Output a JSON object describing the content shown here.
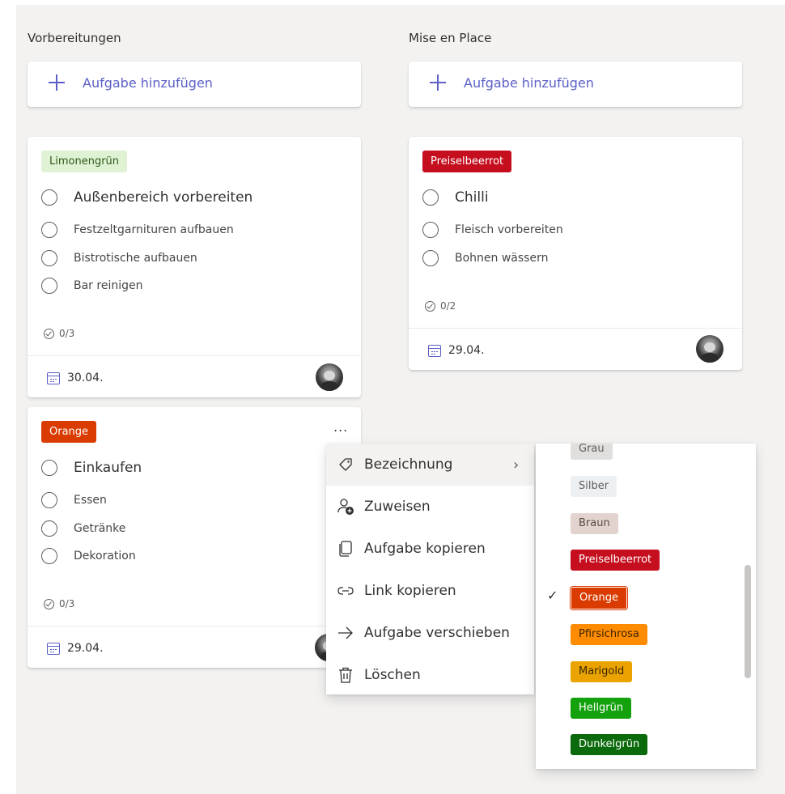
{
  "columns": [
    {
      "title": "Vorbereitungen",
      "add_label": "Aufgabe hinzufügen"
    },
    {
      "title": "Mise en Place",
      "add_label": "Aufgabe hinzufügen"
    }
  ],
  "cards": {
    "aussenbereich": {
      "label": "Limonengrün",
      "title": "Außenbereich vorbereiten",
      "items": [
        "Festzeltgarnituren aufbauen",
        "Bistrotische aufbauen",
        "Bar reinigen"
      ],
      "progress": "0/3",
      "date": "30.04."
    },
    "chilli": {
      "label": "Preiselbeerrot",
      "title": "Chilli",
      "items": [
        "Fleisch vorbereiten",
        "Bohnen wässern"
      ],
      "progress": "0/2",
      "date": "29.04."
    },
    "einkaufen": {
      "label": "Orange",
      "title": "Einkaufen",
      "items": [
        "Essen",
        "Getränke",
        "Dekoration"
      ],
      "progress": "0/3",
      "date": "29.04.",
      "more_label": "..."
    }
  },
  "context_menu": {
    "items": [
      {
        "label": "Bezeichnung",
        "icon": "tag-icon"
      },
      {
        "label": "Zuweisen",
        "icon": "person-add-icon"
      },
      {
        "label": "Aufgabe kopieren",
        "icon": "copy-icon"
      },
      {
        "label": "Link kopieren",
        "icon": "link-icon"
      },
      {
        "label": "Aufgabe verschieben",
        "icon": "arrow-right-icon"
      },
      {
        "label": "Löschen",
        "icon": "trash-icon"
      }
    ],
    "submenu_arrow": "›"
  },
  "label_menu": {
    "labels": [
      {
        "name": "Grau",
        "bg": "#e1dfdd",
        "fg": "#605e5c"
      },
      {
        "name": "Silber",
        "bg": "#edf0f2",
        "fg": "#605e5c"
      },
      {
        "name": "Braun",
        "bg": "#e3d3cf",
        "fg": "#5b4a44"
      },
      {
        "name": "Preiselbeerrot",
        "bg": "#c50f1f",
        "fg": "#ffffff"
      },
      {
        "name": "Orange",
        "bg": "#da3b01",
        "fg": "#ffffff",
        "selected": true
      },
      {
        "name": "Pfirsichrosa",
        "bg": "#ff8c00",
        "fg": "#3b2300"
      },
      {
        "name": "Marigold",
        "bg": "#eaa300",
        "fg": "#3b2900"
      },
      {
        "name": "Hellgrün",
        "bg": "#13a10e",
        "fg": "#ffffff"
      },
      {
        "name": "Dunkelgrün",
        "bg": "#0b6a0b",
        "fg": "#ffffff"
      }
    ],
    "check_mark": "✓"
  },
  "colors": {
    "accent": "#5b5fc7",
    "limonengruen_bg": "#dff3d4",
    "limonengruen_fg": "#2f5718",
    "preiselbeerrot": "#c50f1f",
    "orange": "#da3b01"
  }
}
